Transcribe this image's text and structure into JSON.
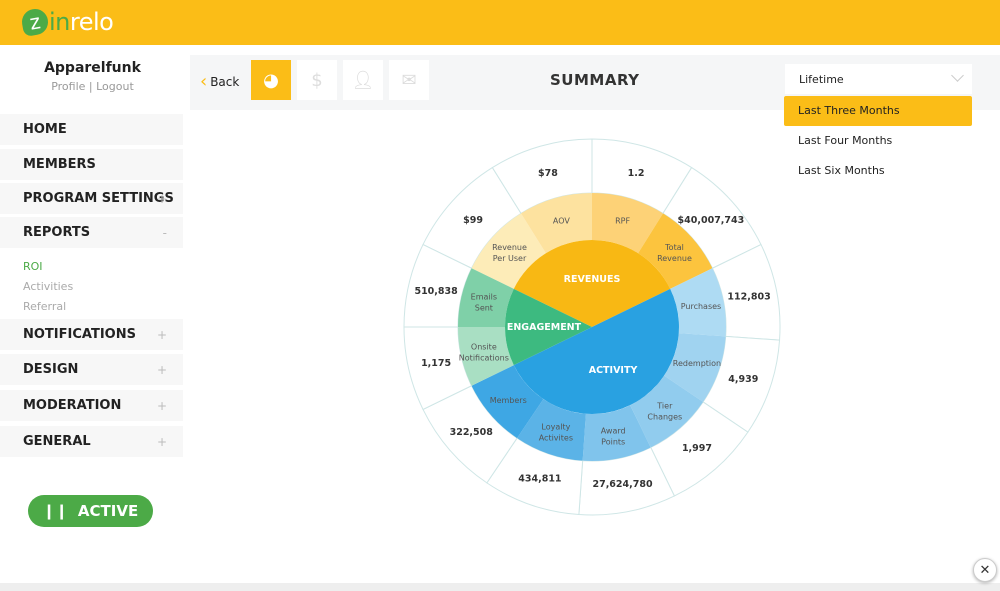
{
  "header": {
    "logo_text": "zinrelo",
    "brand_color": "#fbbd17"
  },
  "sidebar": {
    "account_name": "Apparelfunk",
    "profile_label": "Profile",
    "logout_label": "Logout",
    "items": [
      {
        "label": "HOME",
        "toggle": ""
      },
      {
        "label": "MEMBERS",
        "toggle": ""
      },
      {
        "label": "PROGRAM SETTINGS",
        "toggle": "+"
      },
      {
        "label": "REPORTS",
        "toggle": "-"
      },
      {
        "label": "NOTIFICATIONS",
        "toggle": "+"
      },
      {
        "label": "DESIGN",
        "toggle": "+"
      },
      {
        "label": "MODERATION",
        "toggle": "+"
      },
      {
        "label": "GENERAL",
        "toggle": "+"
      }
    ],
    "reports_sub": [
      {
        "label": "ROI",
        "active": true
      },
      {
        "label": "Activities",
        "active": false
      },
      {
        "label": "Referral",
        "active": false
      }
    ],
    "status_button": {
      "icon": "pause-icon",
      "label": "ACTIVE",
      "color": "#4caa47"
    }
  },
  "toolbar": {
    "back_label": "Back",
    "tabs": [
      {
        "icon": "chart-icon",
        "active": true
      },
      {
        "icon": "dollar-icon",
        "active": false
      },
      {
        "icon": "user-icon",
        "active": false
      },
      {
        "icon": "mail-icon",
        "active": false
      }
    ],
    "title": "SUMMARY"
  },
  "period": {
    "selected": "Lifetime",
    "options": [
      "Last Three Months",
      "Last Four Months",
      "Last Six Months"
    ],
    "highlighted": "Last Three Months"
  },
  "chart_data": {
    "type": "sunburst",
    "groups": [
      {
        "name": "REVENUES",
        "color": "#f8b814",
        "items": [
          {
            "label": [
              "Revenue",
              "Per User"
            ],
            "value": "$99",
            "color": "#fdecb8"
          },
          {
            "label": [
              "AOV"
            ],
            "value": "$78",
            "color": "#fde29f"
          },
          {
            "label": [
              "RPF"
            ],
            "value": "1.2",
            "color": "#fdd277"
          },
          {
            "label": [
              "Total",
              "Revenue"
            ],
            "value": "$40,007,743",
            "color": "#fcc43e"
          }
        ]
      },
      {
        "name": "ACTIVITY",
        "color": "#29a1e1",
        "items": [
          {
            "label": [
              "Purchases"
            ],
            "value": "112,803",
            "color": "#aedbf3"
          },
          {
            "label": [
              "Redemption"
            ],
            "value": "4,939",
            "color": "#a0d3f0"
          },
          {
            "label": [
              "Tier",
              "Changes"
            ],
            "value": "1,997",
            "color": "#91ccee"
          },
          {
            "label": [
              "Award",
              "Points"
            ],
            "value": "27,624,780",
            "color": "#80c4ec"
          },
          {
            "label": [
              "Loyalty",
              "Activites"
            ],
            "value": "434,811",
            "color": "#5bb3e7"
          },
          {
            "label": [
              "Members"
            ],
            "value": "322,508",
            "color": "#3ea7e4"
          }
        ]
      },
      {
        "name": "ENGAGEMENT",
        "color": "#3dba80",
        "items": [
          {
            "label": [
              "Onsite",
              "Notifications"
            ],
            "value": "1,175",
            "color": "#a9dfc3"
          },
          {
            "label": [
              "Emails",
              "Sent"
            ],
            "value": "510,838",
            "color": "#7fd0a8"
          }
        ]
      }
    ]
  },
  "footer": {
    "close_label": "✕"
  }
}
